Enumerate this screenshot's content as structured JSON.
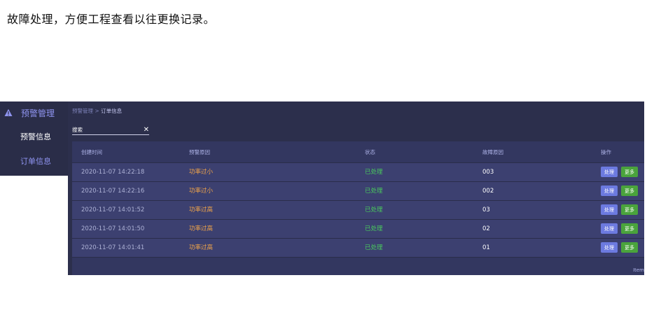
{
  "doc": {
    "caption": "故障处理，方便工程查看以往更换记录。"
  },
  "sidebar": {
    "group_label": "预警管理",
    "items": [
      {
        "label": "预警信息",
        "active": false
      },
      {
        "label": "订单信息",
        "active": true
      }
    ]
  },
  "breadcrumb": {
    "root": "预警管理",
    "separator": ">",
    "current": "订单信息"
  },
  "search": {
    "value": "搜索"
  },
  "table": {
    "headers": [
      "创建时间",
      "预警原因",
      "状态",
      "故障原因",
      "操作"
    ],
    "rows": [
      {
        "time": "2020-11-07 14:22:18",
        "reason": "功率过小",
        "status": "已处理",
        "code": "003",
        "btn_handle": "处理",
        "btn_more": "更多"
      },
      {
        "time": "2020-11-07 14:22:16",
        "reason": "功率过小",
        "status": "已处理",
        "code": "002",
        "btn_handle": "处理",
        "btn_more": "更多"
      },
      {
        "time": "2020-11-07 14:01:52",
        "reason": "功率过高",
        "status": "已处理",
        "code": "03",
        "btn_handle": "处理",
        "btn_more": "更多"
      },
      {
        "time": "2020-11-07 14:01:50",
        "reason": "功率过高",
        "status": "已处理",
        "code": "02",
        "btn_handle": "处理",
        "btn_more": "更多"
      },
      {
        "time": "2020-11-07 14:01:41",
        "reason": "功率过高",
        "status": "已处理",
        "code": "01",
        "btn_handle": "处理",
        "btn_more": "更多"
      }
    ],
    "footer": "Item"
  },
  "icons": {
    "group": "warning-triangle-icon",
    "clear": "close-icon"
  },
  "colors": {
    "sidebar_bg": "#2a2d48",
    "panel_bg": "#333760",
    "accent": "#8f94f0",
    "status_ok": "#49c95d",
    "warning_text": "#f0a44a",
    "btn_handle": "#6c7ae0",
    "btn_more": "#4aa33c"
  }
}
